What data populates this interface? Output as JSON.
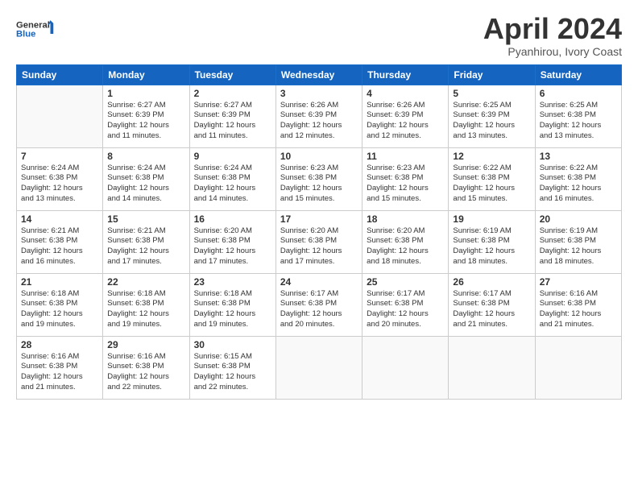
{
  "header": {
    "logo_line1": "General",
    "logo_line2": "Blue",
    "month_title": "April 2024",
    "subtitle": "Pyanhirou, Ivory Coast"
  },
  "weekdays": [
    "Sunday",
    "Monday",
    "Tuesday",
    "Wednesday",
    "Thursday",
    "Friday",
    "Saturday"
  ],
  "weeks": [
    [
      {
        "day": "",
        "info": ""
      },
      {
        "day": "1",
        "info": "Sunrise: 6:27 AM\nSunset: 6:39 PM\nDaylight: 12 hours\nand 11 minutes."
      },
      {
        "day": "2",
        "info": "Sunrise: 6:27 AM\nSunset: 6:39 PM\nDaylight: 12 hours\nand 11 minutes."
      },
      {
        "day": "3",
        "info": "Sunrise: 6:26 AM\nSunset: 6:39 PM\nDaylight: 12 hours\nand 12 minutes."
      },
      {
        "day": "4",
        "info": "Sunrise: 6:26 AM\nSunset: 6:39 PM\nDaylight: 12 hours\nand 12 minutes."
      },
      {
        "day": "5",
        "info": "Sunrise: 6:25 AM\nSunset: 6:39 PM\nDaylight: 12 hours\nand 13 minutes."
      },
      {
        "day": "6",
        "info": "Sunrise: 6:25 AM\nSunset: 6:38 PM\nDaylight: 12 hours\nand 13 minutes."
      }
    ],
    [
      {
        "day": "7",
        "info": "Sunrise: 6:24 AM\nSunset: 6:38 PM\nDaylight: 12 hours\nand 13 minutes."
      },
      {
        "day": "8",
        "info": "Sunrise: 6:24 AM\nSunset: 6:38 PM\nDaylight: 12 hours\nand 14 minutes."
      },
      {
        "day": "9",
        "info": "Sunrise: 6:24 AM\nSunset: 6:38 PM\nDaylight: 12 hours\nand 14 minutes."
      },
      {
        "day": "10",
        "info": "Sunrise: 6:23 AM\nSunset: 6:38 PM\nDaylight: 12 hours\nand 15 minutes."
      },
      {
        "day": "11",
        "info": "Sunrise: 6:23 AM\nSunset: 6:38 PM\nDaylight: 12 hours\nand 15 minutes."
      },
      {
        "day": "12",
        "info": "Sunrise: 6:22 AM\nSunset: 6:38 PM\nDaylight: 12 hours\nand 15 minutes."
      },
      {
        "day": "13",
        "info": "Sunrise: 6:22 AM\nSunset: 6:38 PM\nDaylight: 12 hours\nand 16 minutes."
      }
    ],
    [
      {
        "day": "14",
        "info": "Sunrise: 6:21 AM\nSunset: 6:38 PM\nDaylight: 12 hours\nand 16 minutes."
      },
      {
        "day": "15",
        "info": "Sunrise: 6:21 AM\nSunset: 6:38 PM\nDaylight: 12 hours\nand 17 minutes."
      },
      {
        "day": "16",
        "info": "Sunrise: 6:20 AM\nSunset: 6:38 PM\nDaylight: 12 hours\nand 17 minutes."
      },
      {
        "day": "17",
        "info": "Sunrise: 6:20 AM\nSunset: 6:38 PM\nDaylight: 12 hours\nand 17 minutes."
      },
      {
        "day": "18",
        "info": "Sunrise: 6:20 AM\nSunset: 6:38 PM\nDaylight: 12 hours\nand 18 minutes."
      },
      {
        "day": "19",
        "info": "Sunrise: 6:19 AM\nSunset: 6:38 PM\nDaylight: 12 hours\nand 18 minutes."
      },
      {
        "day": "20",
        "info": "Sunrise: 6:19 AM\nSunset: 6:38 PM\nDaylight: 12 hours\nand 18 minutes."
      }
    ],
    [
      {
        "day": "21",
        "info": "Sunrise: 6:18 AM\nSunset: 6:38 PM\nDaylight: 12 hours\nand 19 minutes."
      },
      {
        "day": "22",
        "info": "Sunrise: 6:18 AM\nSunset: 6:38 PM\nDaylight: 12 hours\nand 19 minutes."
      },
      {
        "day": "23",
        "info": "Sunrise: 6:18 AM\nSunset: 6:38 PM\nDaylight: 12 hours\nand 19 minutes."
      },
      {
        "day": "24",
        "info": "Sunrise: 6:17 AM\nSunset: 6:38 PM\nDaylight: 12 hours\nand 20 minutes."
      },
      {
        "day": "25",
        "info": "Sunrise: 6:17 AM\nSunset: 6:38 PM\nDaylight: 12 hours\nand 20 minutes."
      },
      {
        "day": "26",
        "info": "Sunrise: 6:17 AM\nSunset: 6:38 PM\nDaylight: 12 hours\nand 21 minutes."
      },
      {
        "day": "27",
        "info": "Sunrise: 6:16 AM\nSunset: 6:38 PM\nDaylight: 12 hours\nand 21 minutes."
      }
    ],
    [
      {
        "day": "28",
        "info": "Sunrise: 6:16 AM\nSunset: 6:38 PM\nDaylight: 12 hours\nand 21 minutes."
      },
      {
        "day": "29",
        "info": "Sunrise: 6:16 AM\nSunset: 6:38 PM\nDaylight: 12 hours\nand 22 minutes."
      },
      {
        "day": "30",
        "info": "Sunrise: 6:15 AM\nSunset: 6:38 PM\nDaylight: 12 hours\nand 22 minutes."
      },
      {
        "day": "",
        "info": ""
      },
      {
        "day": "",
        "info": ""
      },
      {
        "day": "",
        "info": ""
      },
      {
        "day": "",
        "info": ""
      }
    ]
  ]
}
